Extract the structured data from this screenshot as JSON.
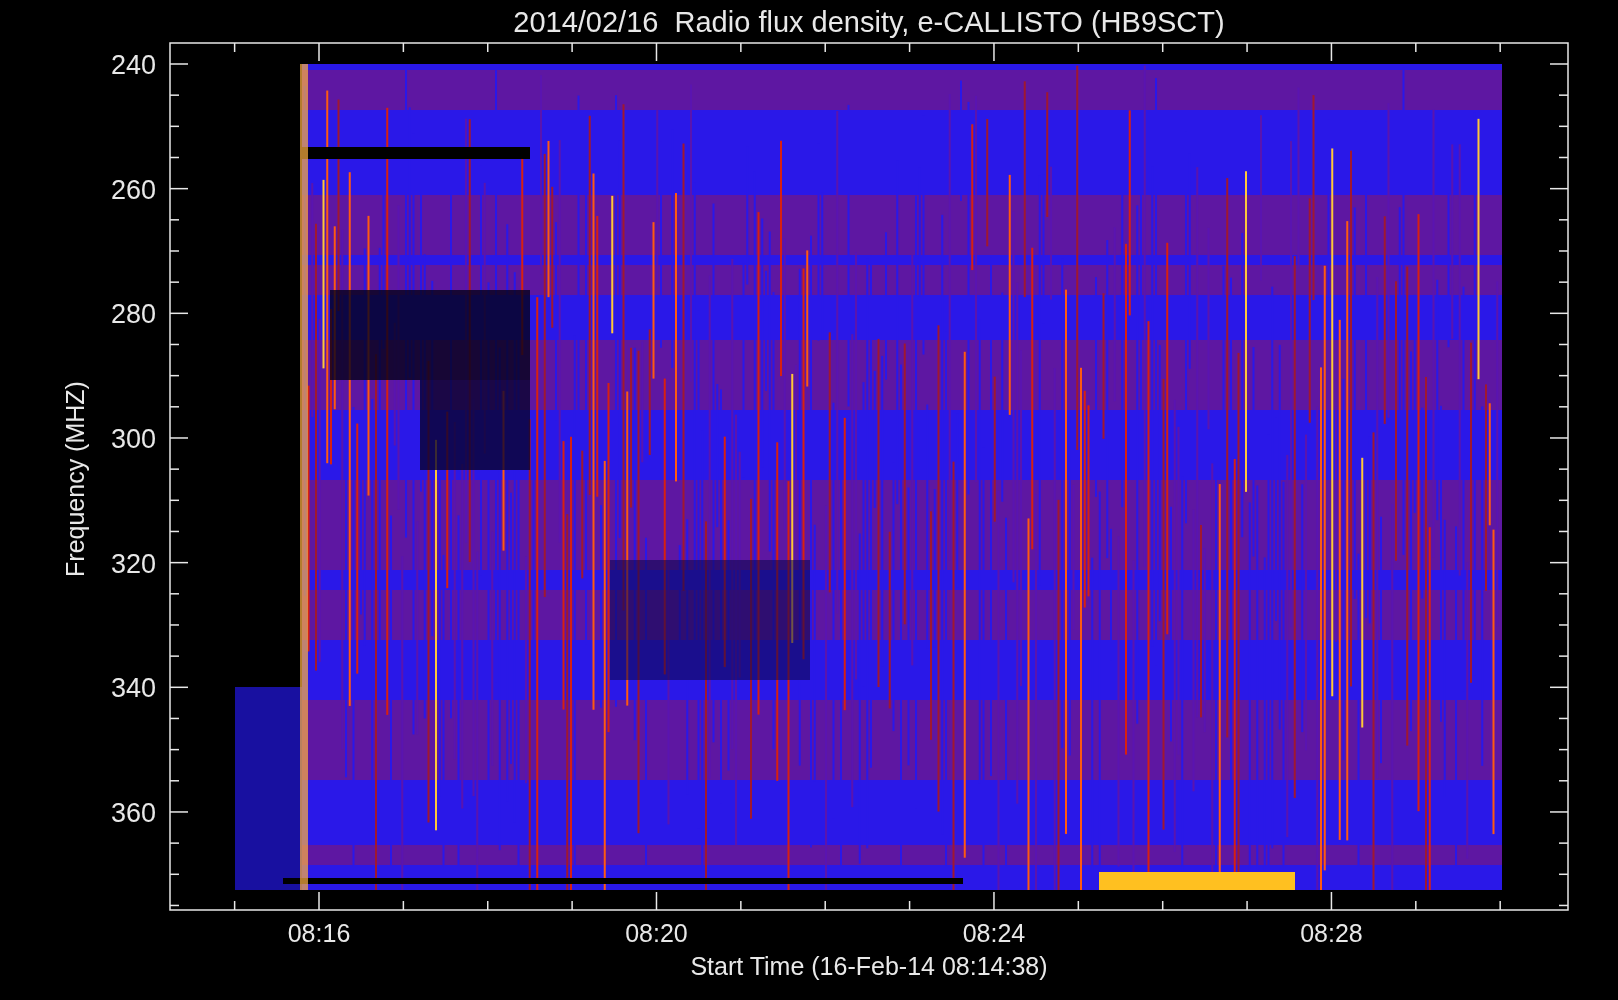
{
  "title": "2014/02/16  Radio flux density, e-CALLISTO (HB9SCT)",
  "y_axis": {
    "label": "Frequency (MHZ)",
    "ticks": [
      "240",
      "260",
      "280",
      "300",
      "320",
      "340",
      "360"
    ]
  },
  "x_axis": {
    "label": "Start Time (16-Feb-14 08:14:38)",
    "ticks": [
      "08:16",
      "08:20",
      "08:24",
      "08:28"
    ]
  }
}
